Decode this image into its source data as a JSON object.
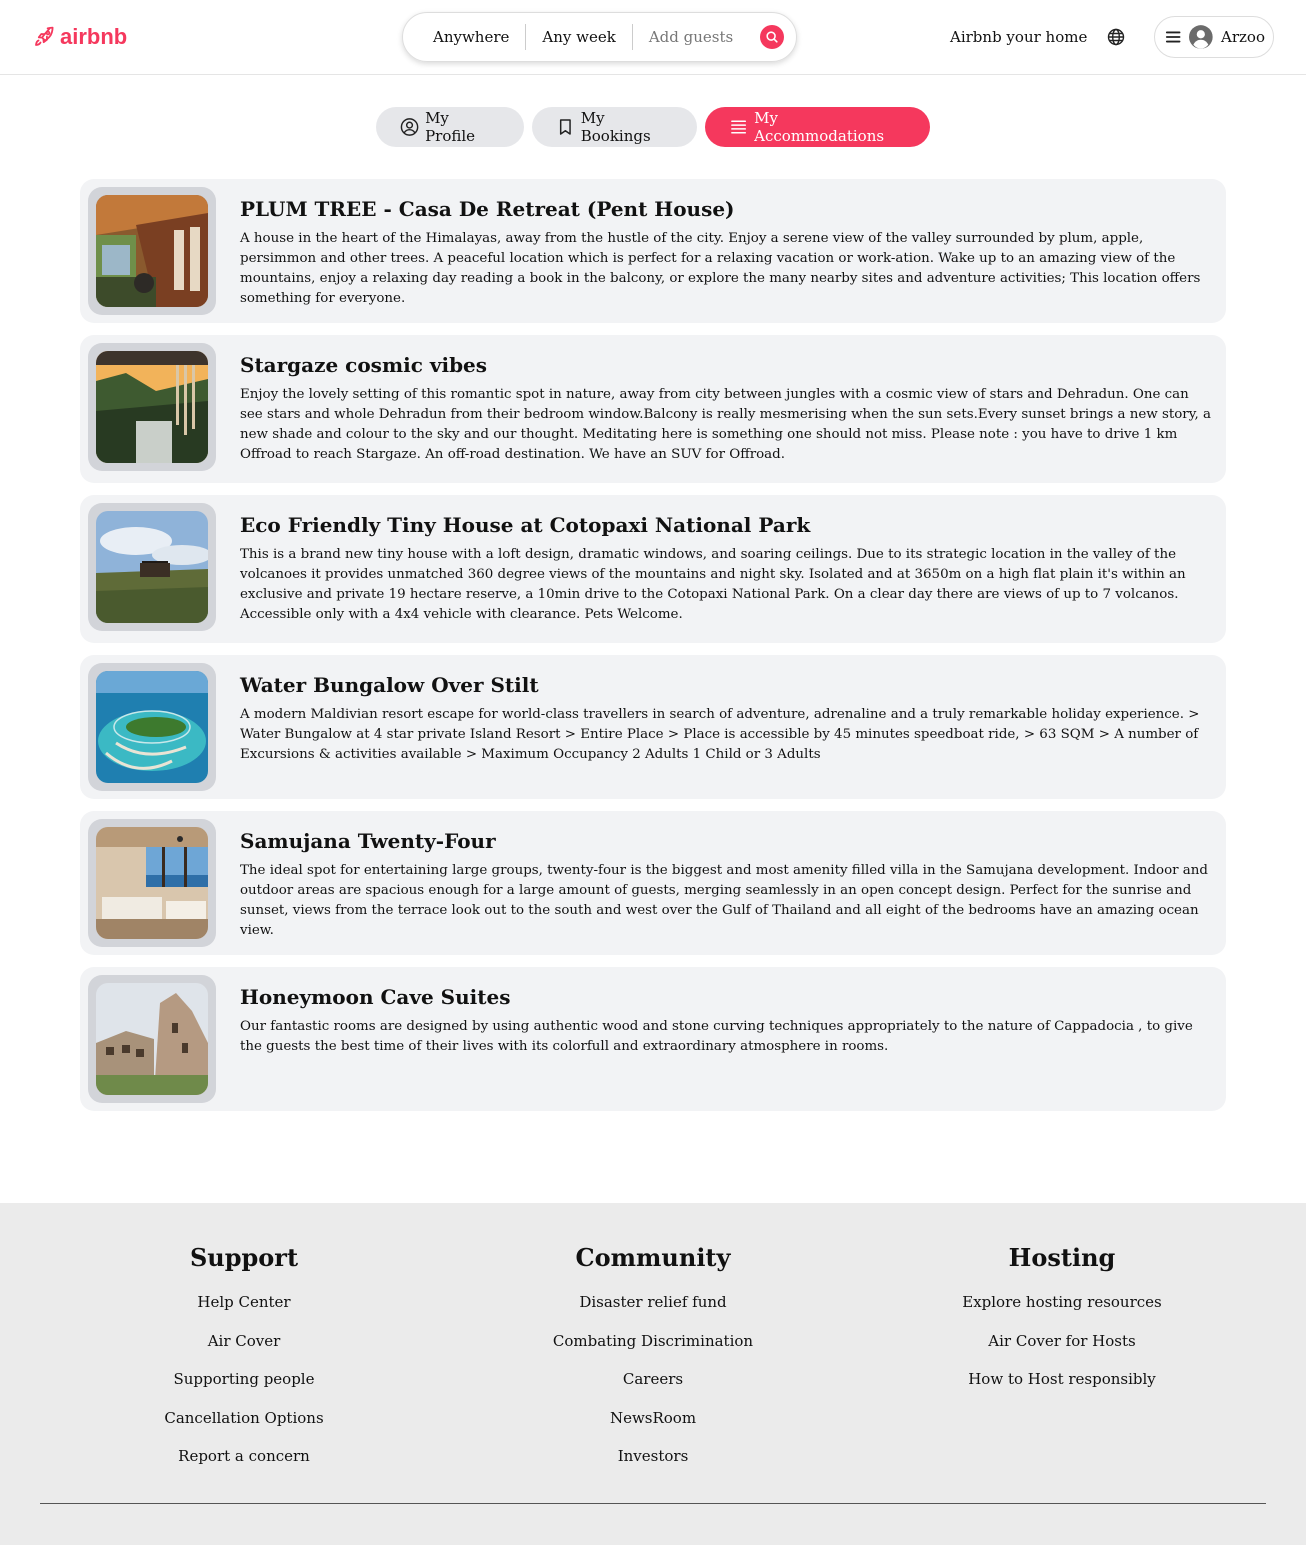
{
  "header": {
    "brand": "airbnb",
    "search": {
      "where": "Anywhere",
      "when": "Any week",
      "guests": "Add guests"
    },
    "host_link": "Airbnb your home",
    "user_name": "Arzoo"
  },
  "tabs": [
    {
      "label": "My Profile",
      "icon": "user-circle-icon",
      "active": false
    },
    {
      "label": "My Bookings",
      "icon": "bookmark-icon",
      "active": false
    },
    {
      "label": "My Accommodations",
      "icon": "list-icon",
      "active": true
    }
  ],
  "colors": {
    "accent": "#f5385d",
    "card_bg": "#f2f3f5",
    "footer_bg": "#ebebeb"
  },
  "accommodations": [
    {
      "title": "PLUM TREE - Casa De Retreat (Pent House)",
      "description": "A house in the heart of the Himalayas, away from the hustle of the city. Enjoy a serene view of the valley surrounded by plum, apple, persimmon and other trees. A peaceful location which is perfect for a relaxing vacation or work-ation. Wake up to an amazing view of the mountains, enjoy a relaxing day reading a book in the balcony, or explore the many nearby sites and adventure activities; This location offers something for everyone."
    },
    {
      "title": "Stargaze cosmic vibes",
      "description": "Enjoy the lovely setting of this romantic spot in nature, away from city between jungles with a cosmic view of stars and Dehradun. One can see stars and whole Dehradun from their bedroom window.Balcony is really mesmerising when the sun sets.Every sunset brings a new story, a new shade and colour to the sky and our thought. Meditating here is something one should not miss. Please note : you have to drive 1 km Offroad to reach Stargaze. An off-road destination. We have an SUV for Offroad."
    },
    {
      "title": "Eco Friendly Tiny House at Cotopaxi National Park",
      "description": "This is a brand new tiny house with a loft design, dramatic windows, and soaring ceilings. Due to its strategic location in the valley of the volcanoes it provides unmatched 360 degree views of the mountains and night sky. Isolated and at 3650m on a high flat plain it's within an exclusive and private 19 hectare reserve, a 10min drive to the Cotopaxi National Park. On a clear day there are views of up to 7 volcanos. Accessible only with a 4x4 vehicle with clearance. Pets Welcome."
    },
    {
      "title": "Water Bungalow Over Stilt",
      "description": "A modern Maldivian resort escape for world-class travellers in search of adventure, adrenaline and a truly remarkable holiday experience. > Water Bungalow at 4 star private Island Resort > Entire Place > Place is accessible by 45 minutes speedboat ride, > 63 SQM > A number of Excursions & activities available > Maximum Occupancy 2 Adults 1 Child or 3 Adults"
    },
    {
      "title": "Samujana Twenty-Four",
      "description": "The ideal spot for entertaining large groups, twenty-four is the biggest and most amenity filled villa in the Samujana development. Indoor and outdoor areas are spacious enough for a large amount of guests, merging seamlessly in an open concept design. Perfect for the sunrise and sunset, views from the terrace look out to the south and west over the Gulf of Thailand and all eight of the bedrooms have an amazing ocean view."
    },
    {
      "title": "Honeymoon Cave Suites",
      "description": "Our fantastic rooms are designed by using authentic wood and stone curving techniques appropriately to the nature of Cappadocia , to give the guests the best time of their lives with its colorfull and extraordinary atmosphere in rooms."
    }
  ],
  "footer": {
    "columns": [
      {
        "title": "Support",
        "links": [
          "Help Center",
          "Air Cover",
          "Supporting people",
          "Cancellation Options",
          "Report a concern"
        ]
      },
      {
        "title": "Community",
        "links": [
          "Disaster relief fund",
          "Combating Discrimination",
          "Careers",
          "NewsRoom",
          "Investors"
        ]
      },
      {
        "title": "Hosting",
        "links": [
          "Explore hosting resources",
          "Air Cover for Hosts",
          "How to Host responsibly"
        ]
      }
    ]
  }
}
